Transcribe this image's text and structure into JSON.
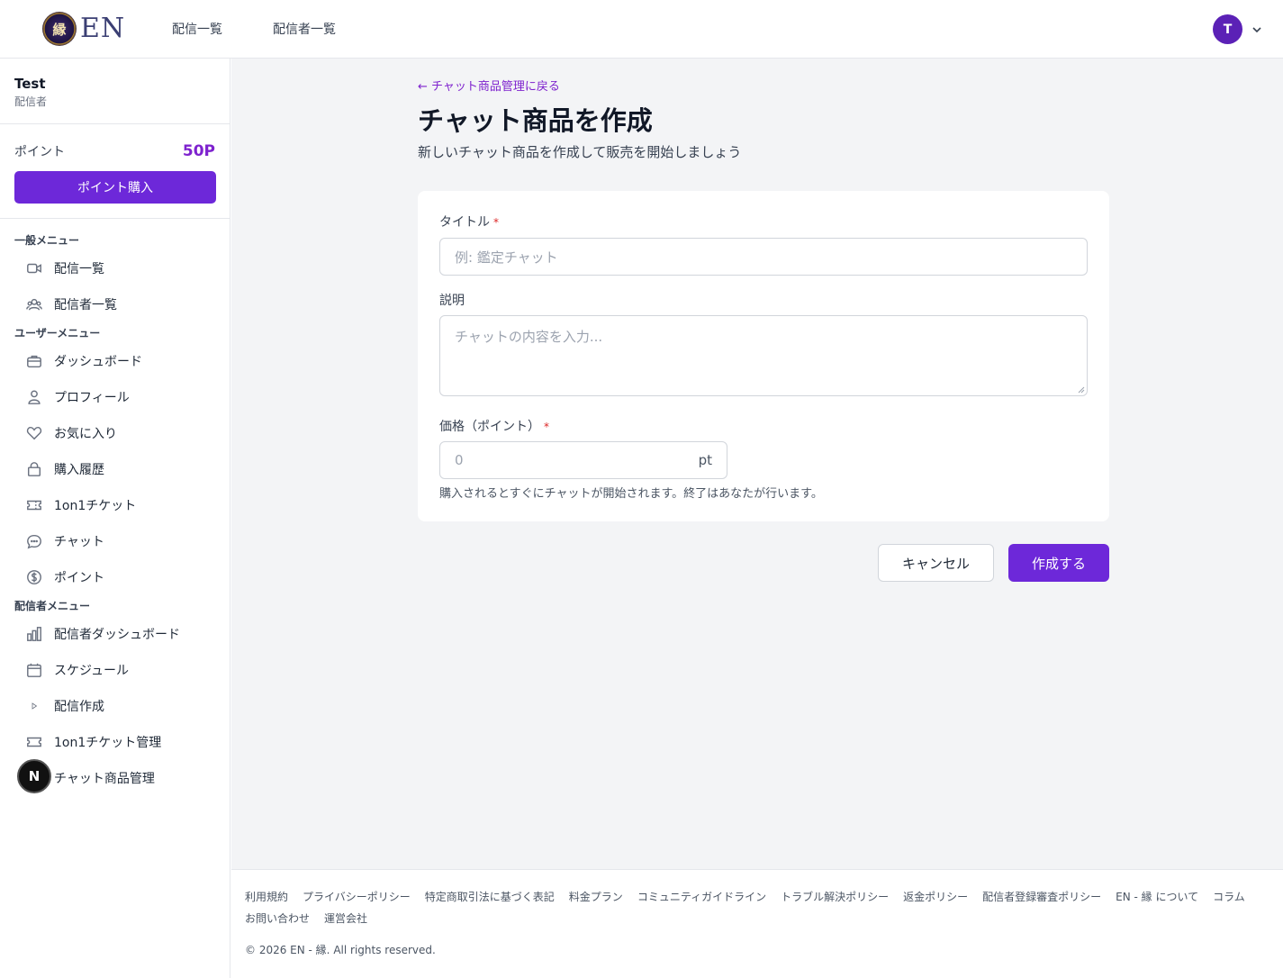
{
  "header": {
    "logo_text": "EN",
    "logo_mark": "縁",
    "nav": [
      "配信一覧",
      "配信者一覧"
    ],
    "avatar_initial": "T"
  },
  "sidebar": {
    "user_name": "Test",
    "user_role": "配信者",
    "points_label": "ポイント",
    "points_value": "50P",
    "buy_button": "ポイント購入",
    "sections": [
      {
        "heading": "一般メニュー",
        "items": [
          {
            "label": "配信一覧",
            "icon": "video-icon"
          },
          {
            "label": "配信者一覧",
            "icon": "users-icon"
          }
        ]
      },
      {
        "heading": "ユーザーメニュー",
        "items": [
          {
            "label": "ダッシュボード",
            "icon": "briefcase-icon"
          },
          {
            "label": "プロフィール",
            "icon": "user-icon"
          },
          {
            "label": "お気に入り",
            "icon": "heart-icon"
          },
          {
            "label": "購入履歴",
            "icon": "shopping-bag-icon"
          },
          {
            "label": "1on1チケット",
            "icon": "ticket-icon"
          },
          {
            "label": "チャット",
            "icon": "chat-bubble-icon"
          },
          {
            "label": "ポイント",
            "icon": "dollar-circle-icon"
          }
        ]
      },
      {
        "heading": "配信者メニュー",
        "items": [
          {
            "label": "配信者ダッシュボード",
            "icon": "bar-chart-icon"
          },
          {
            "label": "スケジュール",
            "icon": "calendar-icon"
          },
          {
            "label": "配信作成",
            "icon": "play-icon"
          },
          {
            "label": "1on1チケット管理",
            "icon": "ticket-icon"
          },
          {
            "label": "チャット商品管理",
            "icon": "chat-bubble-icon"
          }
        ]
      }
    ],
    "next_badge": "N"
  },
  "main": {
    "back_link": "← チャット商品管理に戻る",
    "title": "チャット商品を作成",
    "subtitle": "新しいチャット商品を作成して販売を開始しましょう",
    "form": {
      "title_label": "タイトル",
      "title_placeholder": "例: 鑑定チャット",
      "desc_label": "説明",
      "desc_placeholder": "チャットの内容を入力...",
      "price_label": "価格（ポイント）",
      "price_placeholder": "0",
      "price_unit": "pt",
      "price_help": "購入されるとすぐにチャットが開始されます。終了はあなたが行います。",
      "required_mark": "*"
    },
    "cancel_button": "キャンセル",
    "create_button": "作成する"
  },
  "footer": {
    "links": [
      "利用規約",
      "プライバシーポリシー",
      "特定商取引法に基づく表記",
      "料金プラン",
      "コミュニティガイドライン",
      "トラブル解決ポリシー",
      "返金ポリシー",
      "配信者登録審査ポリシー",
      "EN - 縁 について",
      "コラム",
      "お問い合わせ",
      "運営会社"
    ],
    "copyright": "© 2026 EN - 縁. All rights reserved."
  },
  "colors": {
    "accent": "#6d28d9",
    "accent_text": "#7e22ce",
    "required": "#dc2626",
    "main_bg": "#f3f4f6"
  }
}
